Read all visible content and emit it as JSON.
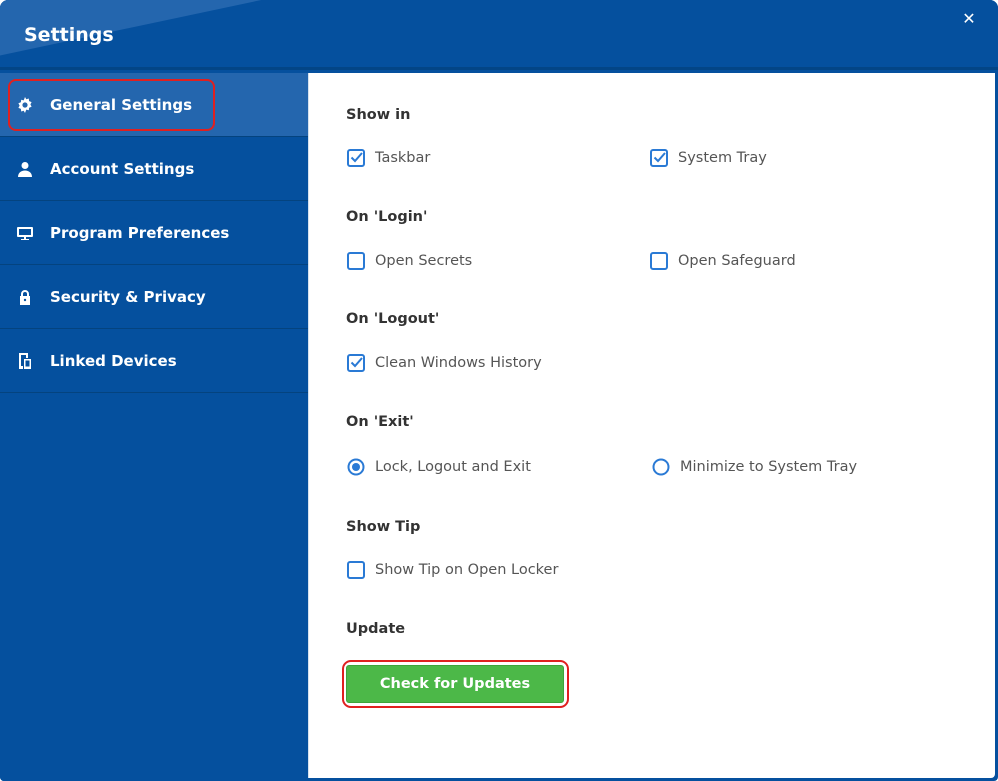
{
  "window": {
    "title": "Settings",
    "close_icon": "close-icon"
  },
  "colors": {
    "brand_blue": "#05509e",
    "active_item": "#2466ae",
    "check_blue": "#2a7ad5",
    "update_green": "#4cb848",
    "highlight_red": "#e02020"
  },
  "sidebar": {
    "items": [
      {
        "label": "General Settings",
        "icon": "gear-icon",
        "active": true
      },
      {
        "label": "Account Settings",
        "icon": "user-icon",
        "active": false
      },
      {
        "label": "Program Preferences",
        "icon": "monitor-icon",
        "active": false
      },
      {
        "label": "Security & Privacy",
        "icon": "lock-icon",
        "active": false
      },
      {
        "label": "Linked Devices",
        "icon": "devices-icon",
        "active": false
      }
    ]
  },
  "general": {
    "show_in": {
      "title": "Show in",
      "taskbar": {
        "label": "Taskbar",
        "checked": true
      },
      "system_tray": {
        "label": "System Tray",
        "checked": true
      }
    },
    "on_login": {
      "title": "On 'Login'",
      "open_secrets": {
        "label": "Open Secrets",
        "checked": false
      },
      "open_safeguard": {
        "label": "Open Safeguard",
        "checked": false
      }
    },
    "on_logout": {
      "title": "On 'Logout'",
      "clean_history": {
        "label": "Clean Windows History",
        "checked": true
      }
    },
    "on_exit": {
      "title": "On 'Exit'",
      "lock_logout_exit": {
        "label": "Lock, Logout and Exit",
        "selected": true
      },
      "minimize_tray": {
        "label": "Minimize to System Tray",
        "selected": false
      }
    },
    "show_tip": {
      "title": "Show Tip",
      "tip_on_open": {
        "label": "Show Tip on Open Locker",
        "checked": false
      }
    },
    "update": {
      "title": "Update",
      "button_label": "Check for Updates"
    }
  }
}
